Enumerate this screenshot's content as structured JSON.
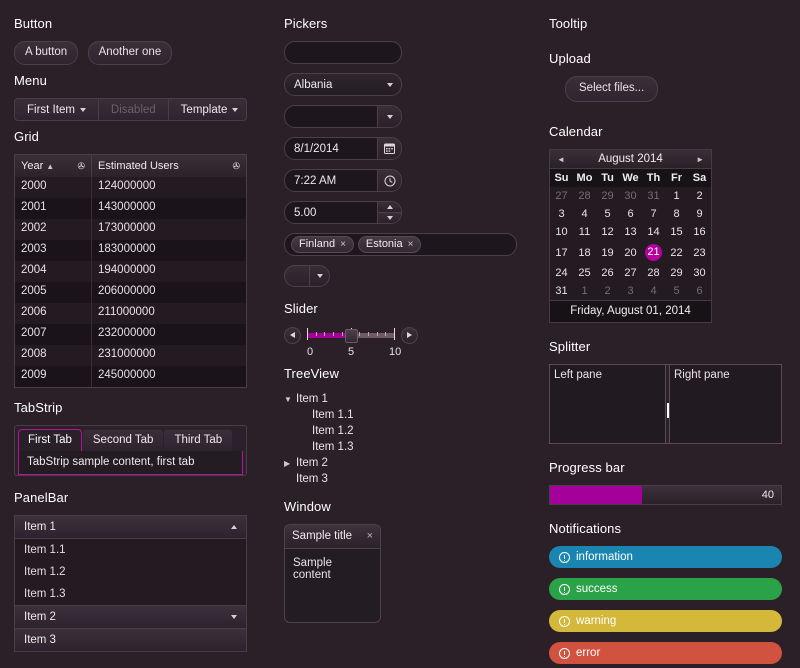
{
  "theme": {
    "background": "#2b2028",
    "accent": "#b5009e",
    "progress_fill": "#a5009a"
  },
  "col1": {
    "button_section": {
      "title": "Button",
      "buttons": [
        "A button",
        "Another one"
      ]
    },
    "menu_section": {
      "title": "Menu",
      "items": [
        {
          "label": "First Item",
          "has_arrow": true,
          "disabled": false
        },
        {
          "label": "Disabled",
          "has_arrow": false,
          "disabled": true
        },
        {
          "label": "Template",
          "has_arrow": true,
          "disabled": false
        }
      ]
    },
    "grid_section": {
      "title": "Grid",
      "columns": [
        "Year",
        "Estimated Users"
      ],
      "sort": {
        "column": "Year",
        "direction": "asc",
        "glyph": "▲"
      },
      "filter_icon": "✇",
      "rows": [
        [
          "2000",
          "124000000"
        ],
        [
          "2001",
          "143000000"
        ],
        [
          "2002",
          "173000000"
        ],
        [
          "2003",
          "183000000"
        ],
        [
          "2004",
          "194000000"
        ],
        [
          "2005",
          "206000000"
        ],
        [
          "2006",
          "211000000"
        ],
        [
          "2007",
          "232000000"
        ],
        [
          "2008",
          "231000000"
        ],
        [
          "2009",
          "245000000"
        ]
      ]
    },
    "tabstrip_section": {
      "title": "TabStrip",
      "tabs": [
        "First Tab",
        "Second Tab",
        "Third Tab"
      ],
      "active_index": 0,
      "content": "TabStrip sample content, first tab"
    },
    "panelbar_section": {
      "title": "PanelBar",
      "items": [
        {
          "label": "Item 1",
          "type": "header",
          "expanded": true,
          "arrow": "up"
        },
        {
          "label": "Item 1.1",
          "type": "child"
        },
        {
          "label": "Item 1.2",
          "type": "child"
        },
        {
          "label": "Item 1.3",
          "type": "child"
        },
        {
          "label": "Item 2",
          "type": "header",
          "expanded": false,
          "arrow": "down"
        },
        {
          "label": "Item 3",
          "type": "header",
          "expanded": false,
          "arrow": "none"
        }
      ]
    }
  },
  "col2": {
    "pickers_section": {
      "title": "Pickers",
      "autocomplete": {
        "value": "",
        "placeholder": ""
      },
      "dropdownlist": {
        "value": "Albania",
        "icon": "chevron-down-icon"
      },
      "combobox": {
        "value": "",
        "icon": "chevron-down-icon"
      },
      "datepicker": {
        "value": "8/1/2014",
        "icon": "calendar-icon"
      },
      "timepicker": {
        "value": "7:22 AM",
        "icon": "clock-icon"
      },
      "numerictextbox": {
        "value": "5.00",
        "icon": "spinner-icon"
      },
      "multiselect": {
        "chips": [
          "Finland",
          "Estonia"
        ],
        "remove_glyph": "×"
      },
      "splitbutton": {
        "label": "",
        "icon": "chevron-down-icon"
      }
    },
    "slider_section": {
      "title": "Slider",
      "value": 5,
      "min": 0,
      "max": 10,
      "tick_labels": [
        "0",
        "5",
        "10"
      ],
      "dec_icon": "triangle-left-icon",
      "inc_icon": "triangle-right-icon"
    },
    "treeview_section": {
      "title": "TreeView",
      "nodes": [
        {
          "label": "Item 1",
          "level": 0,
          "expandable": true,
          "expanded": true
        },
        {
          "label": "Item 1.1",
          "level": 1,
          "expandable": false
        },
        {
          "label": "Item 1.2",
          "level": 1,
          "expandable": false
        },
        {
          "label": "Item 1.3",
          "level": 1,
          "expandable": false
        },
        {
          "label": "Item 2",
          "level": 0,
          "expandable": true,
          "expanded": false
        },
        {
          "label": "Item 3",
          "level": 0,
          "expandable": false
        }
      ]
    },
    "window_section": {
      "title": "Window",
      "window_title": "Sample title",
      "close_glyph": "×",
      "content": "Sample content"
    }
  },
  "col3": {
    "tooltip_section": {
      "title": "Tooltip"
    },
    "upload_section": {
      "title": "Upload",
      "button_label": "Select files..."
    },
    "calendar_section": {
      "title": "Calendar",
      "header": "August 2014",
      "prev_glyph": "◄",
      "next_glyph": "►",
      "weekdays": [
        "Su",
        "Mo",
        "Tu",
        "We",
        "Th",
        "Fr",
        "Sa"
      ],
      "weeks": [
        [
          {
            "d": "27",
            "o": true
          },
          {
            "d": "28",
            "o": true
          },
          {
            "d": "29",
            "o": true
          },
          {
            "d": "30",
            "o": true
          },
          {
            "d": "31",
            "o": true
          },
          {
            "d": "1",
            "o": false
          },
          {
            "d": "2",
            "o": false
          }
        ],
        [
          {
            "d": "3",
            "o": false
          },
          {
            "d": "4",
            "o": false
          },
          {
            "d": "5",
            "o": false
          },
          {
            "d": "6",
            "o": false
          },
          {
            "d": "7",
            "o": false
          },
          {
            "d": "8",
            "o": false
          },
          {
            "d": "9",
            "o": false
          }
        ],
        [
          {
            "d": "10",
            "o": false
          },
          {
            "d": "11",
            "o": false
          },
          {
            "d": "12",
            "o": false
          },
          {
            "d": "13",
            "o": false
          },
          {
            "d": "14",
            "o": false
          },
          {
            "d": "15",
            "o": false
          },
          {
            "d": "16",
            "o": false
          }
        ],
        [
          {
            "d": "17",
            "o": false
          },
          {
            "d": "18",
            "o": false
          },
          {
            "d": "19",
            "o": false
          },
          {
            "d": "20",
            "o": false
          },
          {
            "d": "21",
            "o": false,
            "sel": true
          },
          {
            "d": "22",
            "o": false
          },
          {
            "d": "23",
            "o": false
          }
        ],
        [
          {
            "d": "24",
            "o": false
          },
          {
            "d": "25",
            "o": false
          },
          {
            "d": "26",
            "o": false
          },
          {
            "d": "27",
            "o": false
          },
          {
            "d": "28",
            "o": false
          },
          {
            "d": "29",
            "o": false
          },
          {
            "d": "30",
            "o": false
          }
        ],
        [
          {
            "d": "31",
            "o": false
          },
          {
            "d": "1",
            "o": true
          },
          {
            "d": "2",
            "o": true
          },
          {
            "d": "3",
            "o": true
          },
          {
            "d": "4",
            "o": true
          },
          {
            "d": "5",
            "o": true
          },
          {
            "d": "6",
            "o": true
          }
        ]
      ],
      "footer": "Friday, August 01, 2014"
    },
    "splitter_section": {
      "title": "Splitter",
      "left_pane": "Left pane",
      "right_pane": "Right pane"
    },
    "progress_section": {
      "title": "Progress bar",
      "value": 40,
      "value_label": "40",
      "percent": 40
    },
    "notifications_section": {
      "title": "Notifications",
      "items": [
        {
          "label": "information",
          "color": "#1a85b0",
          "icon": "info-circle-icon"
        },
        {
          "label": "success",
          "color": "#2aa348",
          "icon": "info-circle-icon"
        },
        {
          "label": "warning",
          "color": "#d4b83a",
          "icon": "info-circle-icon"
        },
        {
          "label": "error",
          "color": "#d1523f",
          "icon": "info-circle-icon"
        }
      ]
    }
  }
}
